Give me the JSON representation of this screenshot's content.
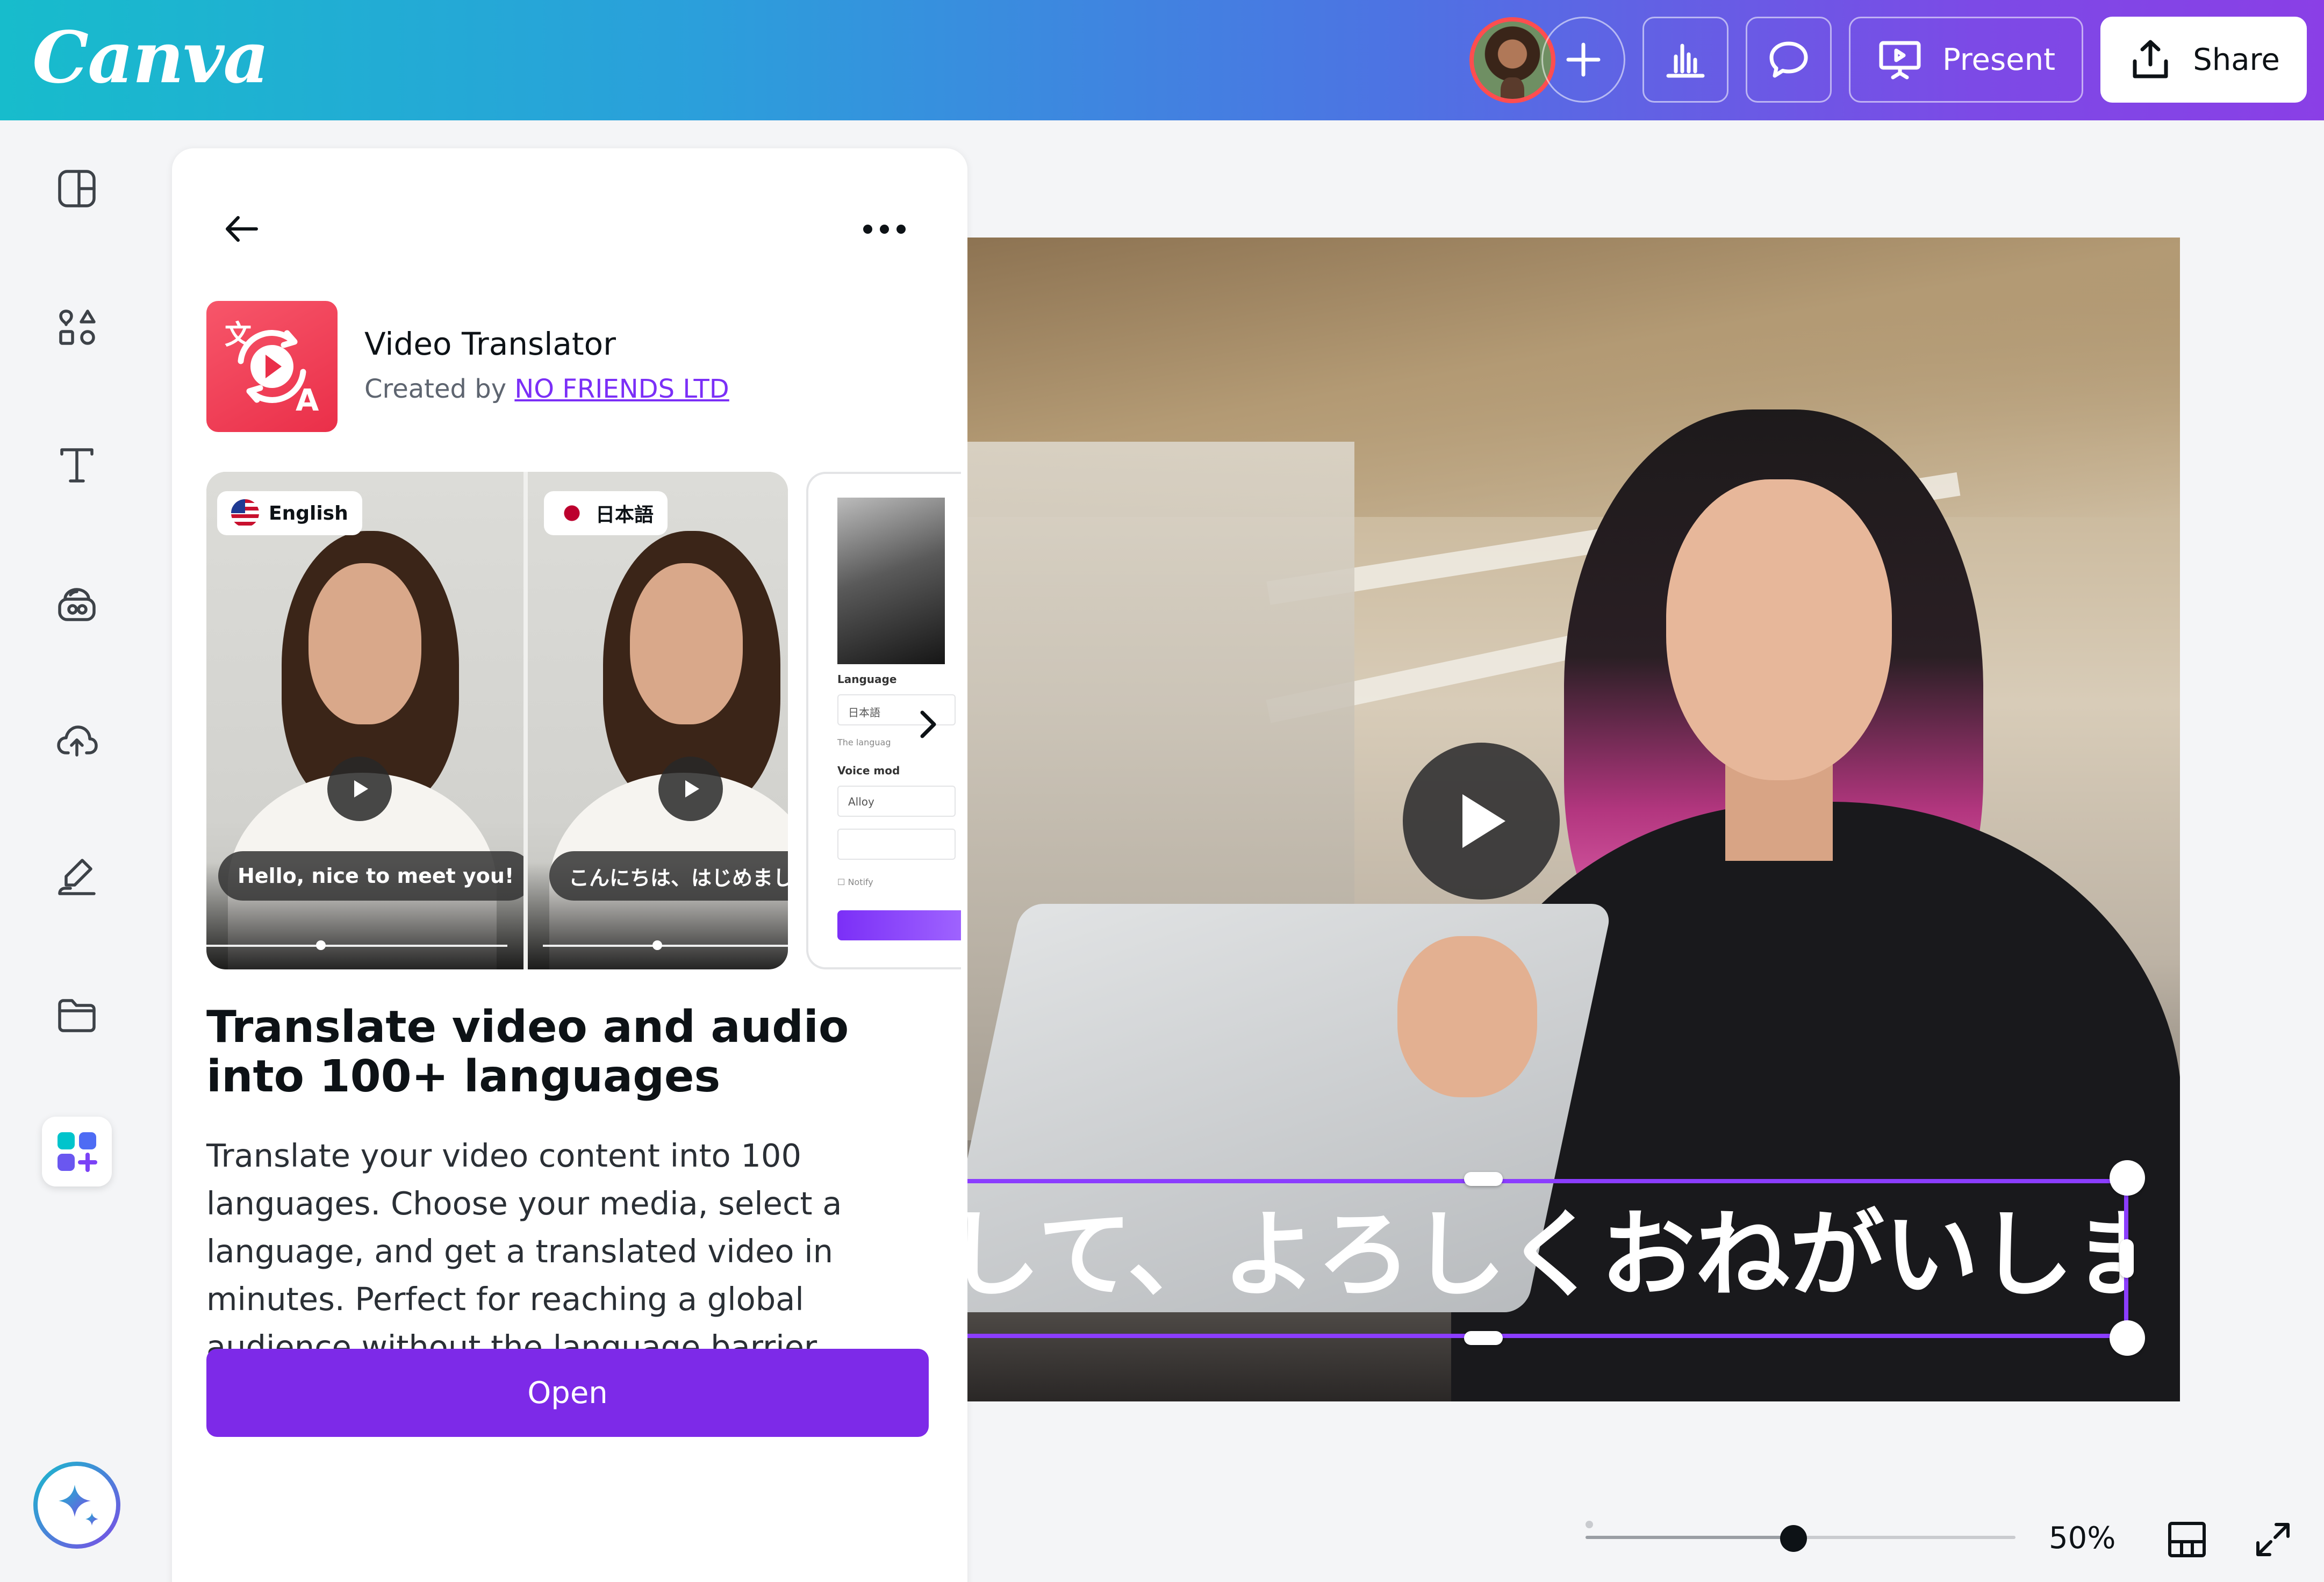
{
  "app": {
    "logo": "Canva"
  },
  "header": {
    "add_collaborator_icon": "plus-icon",
    "insights_icon": "bar-chart-icon",
    "comments_icon": "comment-icon",
    "present_label": "Present",
    "share_label": "Share"
  },
  "sidebar": {
    "items": [
      {
        "icon": "layout-icon",
        "name": "design"
      },
      {
        "icon": "elements-icon",
        "name": "elements"
      },
      {
        "icon": "text-icon",
        "name": "text"
      },
      {
        "icon": "brand-icon",
        "name": "brand"
      },
      {
        "icon": "upload-cloud-icon",
        "name": "uploads"
      },
      {
        "icon": "draw-icon",
        "name": "draw"
      },
      {
        "icon": "folder-icon",
        "name": "projects"
      },
      {
        "icon": "apps-icon",
        "name": "apps",
        "active": true
      }
    ],
    "magic_icon": "sparkle-icon"
  },
  "panel": {
    "app_name": "Video Translator",
    "created_by_prefix": "Created by",
    "developer": "NO FRIENDS LTD",
    "preview": {
      "left_lang": "English",
      "right_lang": "日本語",
      "left_caption": "Hello, nice to meet you!",
      "right_caption": "こんにちは、はじめまし",
      "ui_language_label": "Language",
      "ui_language_value": "日本語",
      "ui_lang_hint": "The languag",
      "ui_voice_label": "Voice mod",
      "ui_voice_value": "Alloy",
      "ui_notify": "Notify"
    },
    "headline": "Translate video and audio into 100+ languages",
    "description": "Translate your video content into 100 languages. Choose your media, select a language, and get a translated video in minutes. Perfect for reaching a global audience without the language barrier.",
    "open_label": "Open"
  },
  "canvas": {
    "subtitle": "して、よろしくおねがいします。"
  },
  "footer": {
    "zoom_label": "50%",
    "zoom_fraction": 0.5
  },
  "colors": {
    "accent": "#7d2ae8",
    "selection": "#8b3dff",
    "app_logo": "#ea2f49"
  }
}
